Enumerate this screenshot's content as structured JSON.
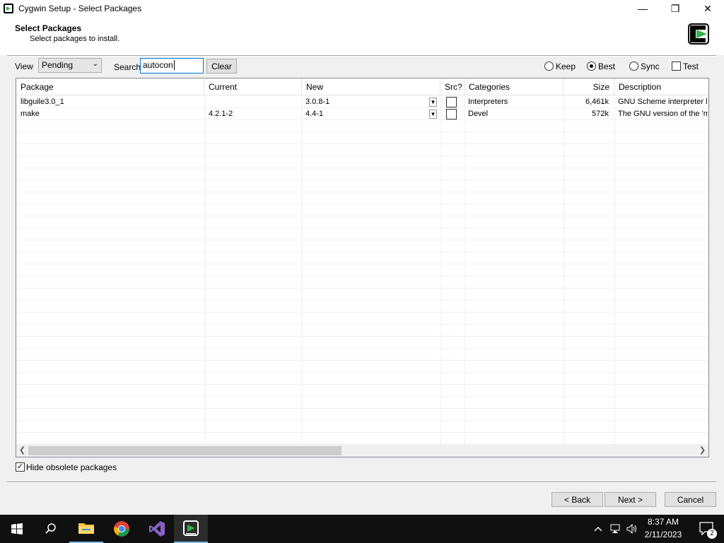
{
  "window": {
    "title": "Cygwin Setup - Select Packages",
    "minimize": "—",
    "maximize": "❐",
    "close": "✕"
  },
  "header": {
    "title": "Select Packages",
    "subtitle": "Select packages to install."
  },
  "toolbar": {
    "view_label": "View",
    "view_value": "Pending",
    "search_label": "Search",
    "search_value": "autocon",
    "clear_label": "Clear",
    "radios": {
      "keep": "Keep",
      "best": "Best",
      "sync": "Sync"
    },
    "selected_radio": "Best",
    "test_label": "Test"
  },
  "grid": {
    "columns": {
      "package": "Package",
      "current": "Current",
      "new": "New",
      "src": "Src?",
      "categories": "Categories",
      "size": "Size",
      "description": "Description"
    },
    "rows": [
      {
        "package": "libguile3.0_1",
        "current": "",
        "new": "3.0.8-1",
        "categories": "Interpreters",
        "size": "6,461k",
        "description": "GNU Scheme interpreter lib"
      },
      {
        "package": "make",
        "current": "4.2.1-2",
        "new": "4.4-1",
        "categories": "Devel",
        "size": "572k",
        "description": "The GNU version of the 'ma"
      }
    ]
  },
  "hide_obsolete_label": "Hide obsolete packages",
  "hide_obsolete_checked": true,
  "buttons": {
    "back": "< Back",
    "next": "Next >",
    "cancel": "Cancel"
  },
  "taskbar": {
    "time": "8:37 AM",
    "date": "2/11/2023",
    "notification_count": "2"
  },
  "colors": {
    "accent": "#0078d7",
    "cygwin_green": "#2fb34a"
  }
}
